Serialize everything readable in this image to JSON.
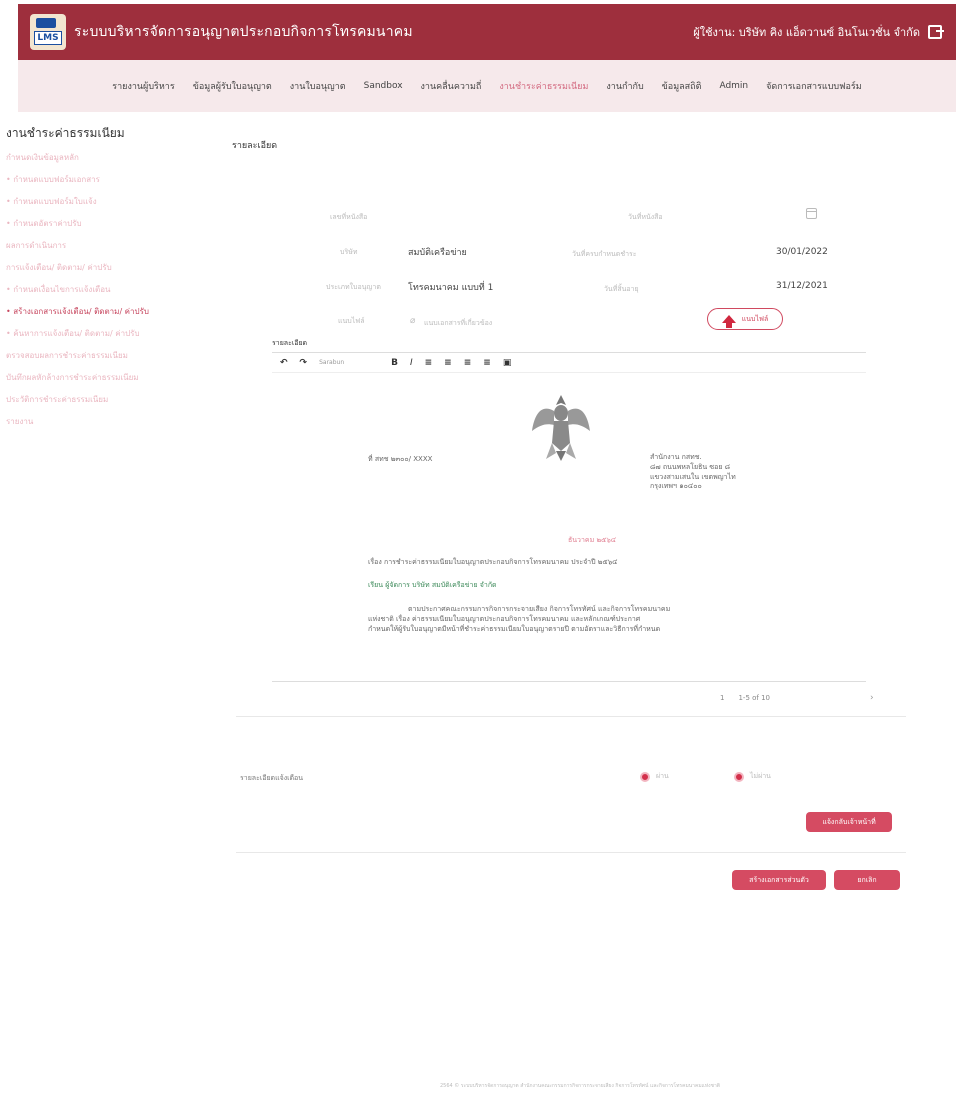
{
  "header": {
    "logo_text": "LMS",
    "system_title": "ระบบบริหารจัดการอนุญาตประกอบกิจการโทรคมนาคม",
    "user_label": "ผู้ใช้งาน: บริษัท คิง แอ็ดวานซ์ อินโนเวชั่น จำกัด"
  },
  "nav": {
    "items": [
      "รายงานผู้บริหาร",
      "ข้อมูลผู้รับใบอนุญาต",
      "งานใบอนุญาต",
      "Sandbox",
      "งานคลื่นความถี่",
      "งานชำระค่าธรรมเนียม",
      "งานกำกับ",
      "ข้อมูลสถิติ",
      "Admin",
      "จัดการเอกสารแบบฟอร์ม"
    ],
    "active_index": 5
  },
  "sidebar": {
    "title": "งานชำระค่าธรรมเนียม",
    "items": [
      "กำหนดเงินข้อมูลหลัก",
      "• กำหนดแบบฟอร์มเอกสาร",
      "• กำหนดแบบฟอร์มใบแจ้ง",
      "• กำหนดอัตราค่าปรับ",
      "ผลการดำเนินการ",
      "การแจ้งเตือน/ ติดตาม/ ค่าปรับ",
      "• กำหนดเงื่อนไขการแจ้งเตือน",
      "• สร้างเอกสารแจ้งเตือน/ ติดตาม/ ค่าปรับ",
      "• ค้นหาการแจ้งเตือน/ ติดตาม/ ค่าปรับ",
      "ตรวจสอบผลการชำระค่าธรรมเนียม",
      "บันทึกผลหักล้างการชำระค่าธรรมเนียม",
      "ประวัติการชำระค่าธรรมเนียม",
      "รายงาน"
    ],
    "active_index": 7
  },
  "main": {
    "section_title": "รายละเอียด",
    "fields": {
      "doc_no_label": "เลขที่หนังสือ",
      "doc_date_label": "วันที่หนังสือ",
      "company_label": "บริษัท",
      "company_value": "สมบัติเครือข่าย",
      "due_date_label": "วันที่ครบกำหนดชำระ",
      "due_date_value": "30/01/2022",
      "license_type_label": "ประเภทใบอนุญาต",
      "license_type_value": "โทรคมนาคม แบบที่ 1",
      "license_end_label": "วันที่สิ้นอายุ",
      "license_end_value": "31/12/2021",
      "attach_label": "แนบไฟล์",
      "attach_placeholder": "แนบเอกสารที่เกี่ยวข้อง",
      "upload_label": "แนบไฟล์"
    },
    "editor": {
      "label": "รายละเอียด",
      "font_placeholder": "Sarabun",
      "doc_no": "ที่ สทช ๒๓๐๐/ XXXX",
      "office_lines": [
        "สำนักงาน กสทช.",
        "๘๗ ถนนพหลโยธิน ซอย ๘",
        "แขวงสามเสนใน เขตพญาไท",
        "กรุงเทพฯ ๑๐๔๐๐"
      ],
      "date_line": "ธันวาคม ๒๕๖๔",
      "subject": "เรื่อง   การชำระค่าธรรมเนียมใบอนุญาตประกอบกิจการโทรคมนาคม ประจำปี ๒๕๖๔",
      "recipient": "เรียน   ผู้จัดการ บริษัท สมบัติเครือข่าย จำกัด",
      "body_lines": [
        "ตามประกาศคณะกรรมการกิจการกระจายเสียง กิจการโทรทัศน์ และกิจการโทรคมนาคม",
        "แห่งชาติ เรื่อง ค่าธรรมเนียมใบอนุญาตประกอบกิจการโทรคมนาคม และหลักเกณฑ์ประกาศ",
        "กำหนดให้ผู้รับใบอนุญาตมีหน้าที่ชำระค่าธรรมเนียมใบอนุญาตรายปี ตามอัตราและวิธีการที่กำหนด"
      ]
    },
    "pager": {
      "page": "1",
      "range": "1-5 of 10"
    },
    "radio_label": "รายละเอียดแจ้งเตือน",
    "radio_options": [
      "ผ่าน",
      "ไม่ผ่าน"
    ],
    "next_btn": "แจ้งกลับเจ้าหน้าที่",
    "create_btn": "สร้างเอกสารส่วนตัว",
    "cancel_btn": "ยกเลิก"
  },
  "footer": "2564 © ระบบบริหารจัดการอนุญาต สำนักงานคณะกรรมการกิจการกระจายเสียง กิจการโทรทัศน์ และกิจการโทรคมนาคมแห่งชาติ"
}
